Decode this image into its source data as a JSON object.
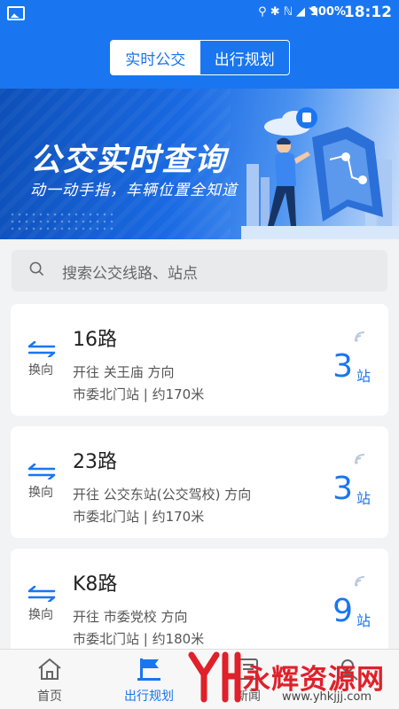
{
  "statusbar": {
    "battery": "100%",
    "time": "18:12"
  },
  "tabs": [
    {
      "label": "实时公交",
      "active": true
    },
    {
      "label": "出行规划",
      "active": false
    }
  ],
  "banner": {
    "title": "公交实时查询",
    "subtitle": "动一动手指，车辆位置全知道"
  },
  "search": {
    "placeholder": "搜索公交线路、站点"
  },
  "cards": [
    {
      "swap_label": "换向",
      "route": "16路",
      "direction": "开往 关王庙 方向",
      "stop": "市委北门站 | 约170米",
      "count": "3",
      "unit": "站"
    },
    {
      "swap_label": "换向",
      "route": "23路",
      "direction": "开往 公交东站(公交驾校) 方向",
      "stop": "市委北门站 | 约170米",
      "count": "3",
      "unit": "站"
    },
    {
      "swap_label": "换向",
      "route": "K8路",
      "direction": "开往 市委党校 方向",
      "stop": "市委北门站 | 约180米",
      "count": "9",
      "unit": "站"
    }
  ],
  "nav": [
    {
      "label": "首页",
      "icon": "home-icon"
    },
    {
      "label": "出行规划",
      "icon": "bus-stop-icon"
    },
    {
      "label": "新闻",
      "icon": "news-icon"
    },
    {
      "label": "",
      "icon": "profile-icon"
    }
  ],
  "watermark": {
    "text": "永辉资源网",
    "url": "www.yhkjjj.com"
  },
  "colors": {
    "primary": "#1976f0",
    "background": "#f2f3f5",
    "watermark": "#e0202a"
  }
}
